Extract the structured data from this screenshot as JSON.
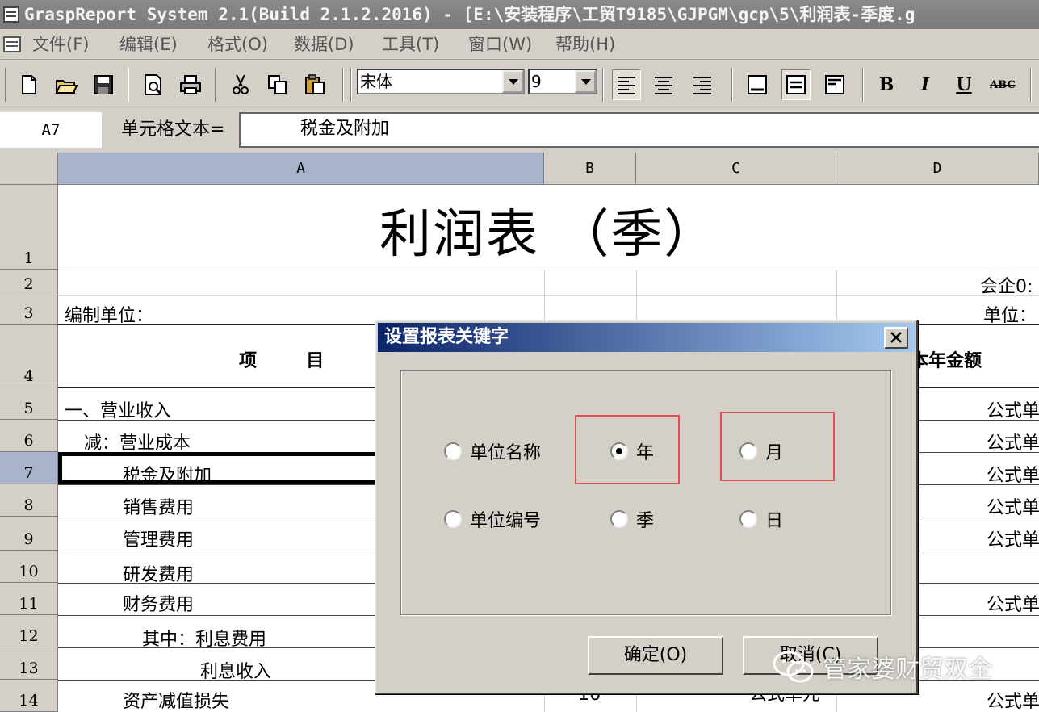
{
  "window": {
    "title": "GraspReport System 2.1(Build 2.1.2.2016) - [E:\\安装程序\\工贸T9185\\GJPGM\\gcp\\5\\利润表-季度.g"
  },
  "menu": [
    "文件(F)",
    "编辑(E)",
    "格式(O)",
    "数据(D)",
    "工具(T)",
    "窗口(W)",
    "帮助(H)"
  ],
  "toolbar": {
    "font_name": "宋体",
    "font_size": "9",
    "bold": "B",
    "italic": "I",
    "underline": "U",
    "strike": "ABC"
  },
  "formula": {
    "cell_ref": "A7",
    "label": "单元格文本=",
    "value": "税金及附加"
  },
  "grid": {
    "columns": [
      "A",
      "B",
      "C",
      "D"
    ],
    "rows": [
      "1",
      "2",
      "3",
      "4",
      "5",
      "6",
      "7",
      "8",
      "9",
      "10",
      "11",
      "12",
      "13",
      "14"
    ],
    "title": "利润表  （季）",
    "r2_d": "会企0:",
    "r3_a": "编制单位：",
    "r3_d": "单位：",
    "r4_a": "项        目",
    "r4_d": "本年金额",
    "items": [
      "一、营业收入",
      "减：营业成本",
      "税金及附加",
      "销售费用",
      "管理费用",
      "研发费用",
      "财务费用",
      "其中：利息费用",
      "利息收入",
      "资产减值损失"
    ],
    "formula_cell": "公式单",
    "r14_b": "16",
    "r14_c": "公式单元"
  },
  "dialog": {
    "title": "设置报表关键字",
    "options": {
      "unit_name": "单位名称",
      "year": "年",
      "month": "月",
      "unit_code": "单位编号",
      "quarter": "季",
      "day": "日"
    },
    "selected": "year",
    "ok": "确定(O)",
    "cancel": "取消(C)"
  },
  "watermark": "管家婆财贸双全",
  "colors": {
    "selected_header": "#a8b4cc",
    "dialog_title_start": "#0a246a",
    "highlight": "#e05050"
  }
}
